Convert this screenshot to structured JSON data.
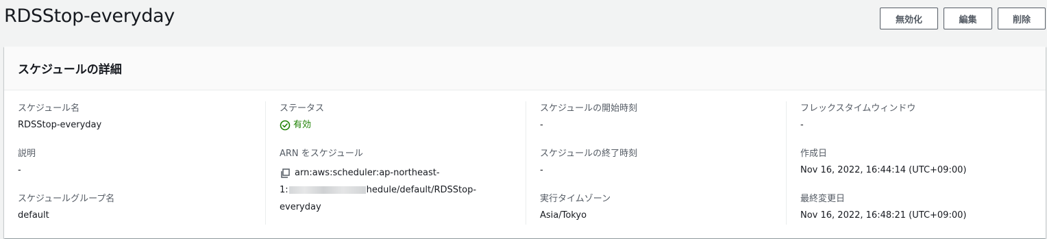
{
  "header": {
    "title": "RDSStop-everyday",
    "buttons": {
      "disable": "無効化",
      "edit": "編集",
      "delete": "削除"
    }
  },
  "panel": {
    "title": "スケジュールの詳細",
    "col1": {
      "schedule_name_label": "スケジュール名",
      "schedule_name_value": "RDSStop-everyday",
      "description_label": "説明",
      "description_value": "-",
      "group_label": "スケジュールグループ名",
      "group_value": "default"
    },
    "col2": {
      "status_label": "ステータス",
      "status_value": "有効",
      "arn_label": "ARN をスケジュール",
      "arn_line1": "arn:aws:scheduler:ap-northeast-",
      "arn_line2_prefix": "1:",
      "arn_line2_suffix": "hedule/default/RDSStop-",
      "arn_line3": "everyday"
    },
    "col3": {
      "start_label": "スケジュールの開始時刻",
      "start_value": "-",
      "end_label": "スケジュールの終了時刻",
      "end_value": "-",
      "timezone_label": "実行タイムゾーン",
      "timezone_value": "Asia/Tokyo"
    },
    "col4": {
      "flex_label": "フレックスタイムウィンドウ",
      "flex_value": "-",
      "created_label": "作成日",
      "created_value": "Nov 16, 2022, 16:44:14 (UTC+09:00)",
      "modified_label": "最終変更日",
      "modified_value": "Nov 16, 2022, 16:48:21 (UTC+09:00)"
    }
  },
  "icons": {
    "status": "check-circle-icon",
    "copy": "copy-icon"
  },
  "colors": {
    "success": "#1d8102",
    "label": "#545b64",
    "text": "#16191f",
    "background": "#f2f3f3"
  }
}
